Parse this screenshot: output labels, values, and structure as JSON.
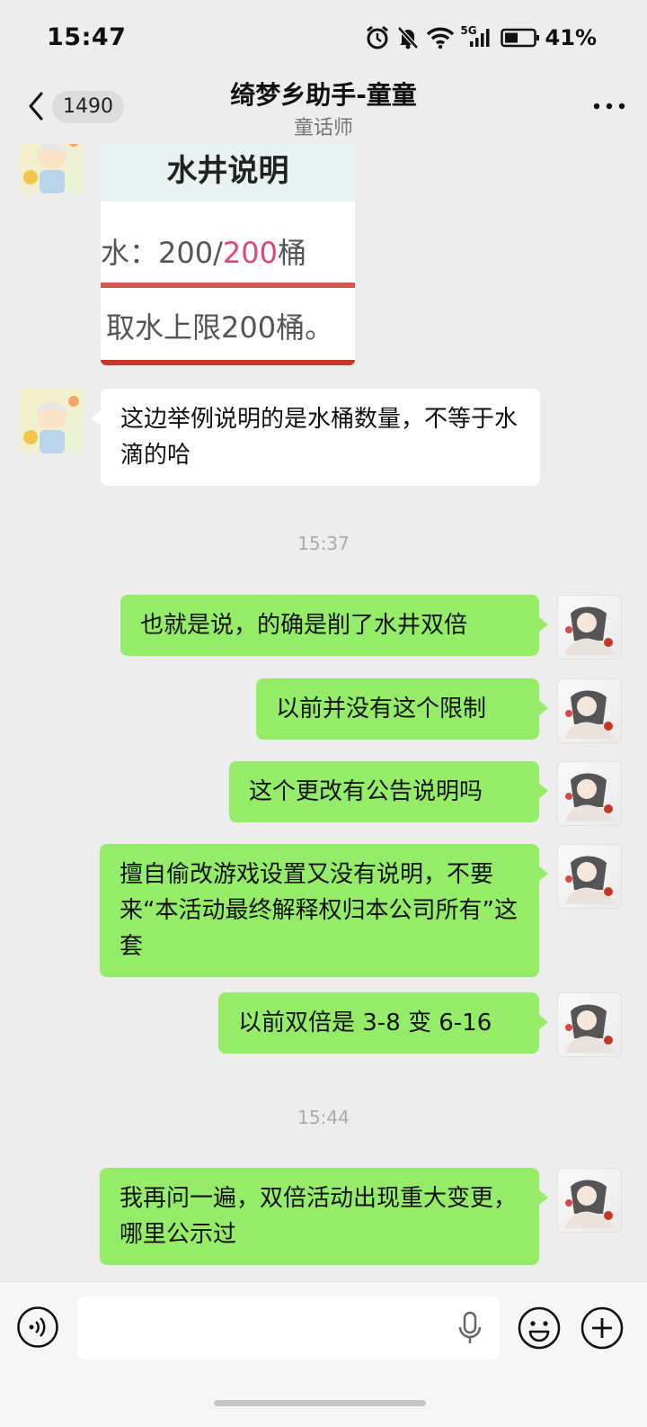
{
  "status": {
    "time": "15:47",
    "network": "5G",
    "battery": "41%"
  },
  "nav": {
    "unread_count": "1490",
    "title": "绮梦乡助手-童童",
    "subtitle": "童话师"
  },
  "image_message": {
    "title": "水井说明",
    "line1_prefix": "水：200/",
    "line1_highlight": "200",
    "line1_suffix": "桶",
    "line2": "取水上限200桶。"
  },
  "messages": [
    {
      "from": "bot",
      "text": "这边举例说明的是水桶数量，不等于水滴的哈"
    },
    {
      "from": "me",
      "text": "也就是说，的确是削了水井双倍"
    },
    {
      "from": "me",
      "text": "以前并没有这个限制"
    },
    {
      "from": "me",
      "text": "这个更改有公告说明吗"
    },
    {
      "from": "me",
      "text": "擅自偷改游戏设置又没有说明，不要来“本活动最终解释权归本公司所有”这套"
    },
    {
      "from": "me",
      "text": "以前双倍是 3-8 变 6-16"
    },
    {
      "from": "me",
      "text": "我再问一遍，双倍活动出现重大变更，哪里公示过"
    }
  ],
  "timestamps": [
    "15:37",
    "15:44"
  ],
  "input": {
    "placeholder": ""
  },
  "colors": {
    "sent_bubble": "#95ec69",
    "received_bubble": "#ffffff",
    "background": "#ededed",
    "highlight": "#e0457a"
  }
}
